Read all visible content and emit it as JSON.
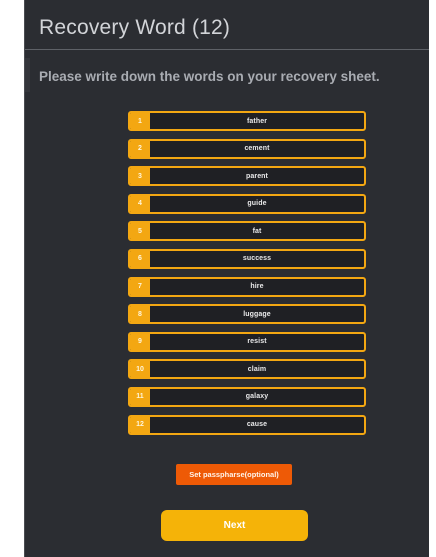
{
  "header": {
    "title": "Recovery Word (12)"
  },
  "instructions": "Please write down the words on your recovery sheet.",
  "words": [
    {
      "num": "1",
      "word": "father"
    },
    {
      "num": "2",
      "word": "cement"
    },
    {
      "num": "3",
      "word": "parent"
    },
    {
      "num": "4",
      "word": "guide"
    },
    {
      "num": "5",
      "word": "fat"
    },
    {
      "num": "6",
      "word": "success"
    },
    {
      "num": "7",
      "word": "hire"
    },
    {
      "num": "8",
      "word": "luggage"
    },
    {
      "num": "9",
      "word": "resist"
    },
    {
      "num": "10",
      "word": "claim"
    },
    {
      "num": "11",
      "word": "galaxy"
    },
    {
      "num": "12",
      "word": "cause"
    }
  ],
  "actions": {
    "passphrase_label": "Set passpharse(optional)",
    "next_label": "Next"
  },
  "colors": {
    "panel_background": "#2b2d32",
    "accent_yellow": "#f3a712",
    "passphrase_orange": "#ee5a06",
    "next_yellow": "#f5b308"
  }
}
